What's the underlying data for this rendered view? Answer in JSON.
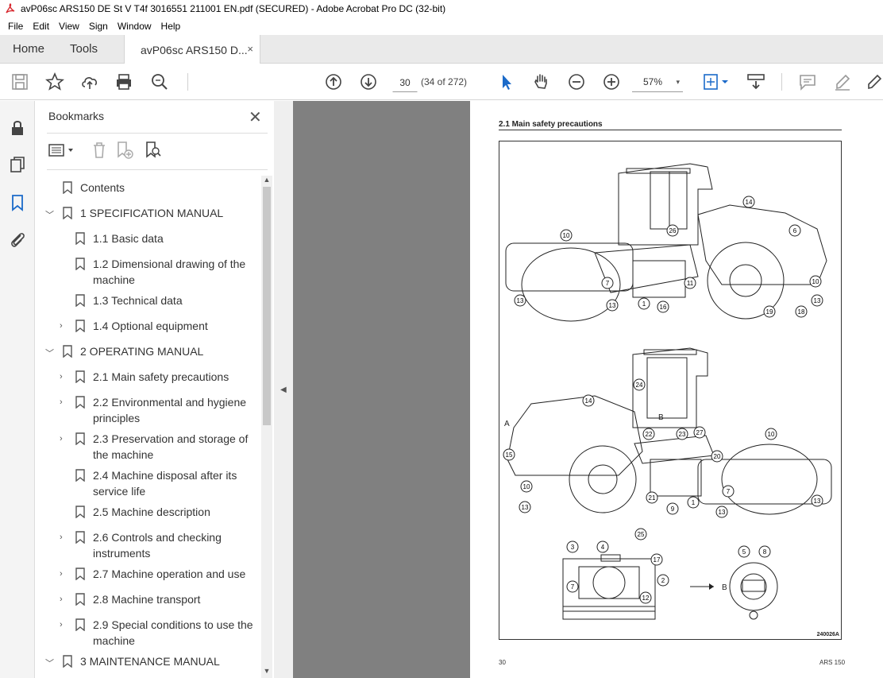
{
  "window": {
    "title": "avP06sc ARS150 DE St V T4f 3016551 211001 EN.pdf (SECURED) - Adobe Acrobat Pro DC (32-bit)"
  },
  "menu": [
    "File",
    "Edit",
    "View",
    "Sign",
    "Window",
    "Help"
  ],
  "tabs": {
    "home": "Home",
    "tools": "Tools",
    "document": "avP06sc ARS150 D...",
    "document_close": "×"
  },
  "toolbar": {
    "page_number": "30",
    "page_count": "(34 of 272)",
    "zoom": "57%",
    "zoom_caret": "▾",
    "icons": [
      "save-icon",
      "star-icon",
      "upload-icon",
      "print-icon",
      "find-icon",
      "page-up-icon",
      "page-down-icon",
      "select-cursor-icon",
      "hand-icon",
      "zoom-out-icon",
      "zoom-in-icon",
      "fit-page-icon",
      "scroll-mode-icon",
      "comment-icon",
      "highlight-icon",
      "sign-icon"
    ]
  },
  "sidebar_rail": {
    "icons": [
      "lock-icon",
      "pages-icon",
      "bookmark-icon",
      "attachment-icon"
    ]
  },
  "bookmarks": {
    "title": "Bookmarks",
    "close": "✕",
    "items": [
      {
        "label": "Contents",
        "level": 0,
        "chevron": "",
        "lines": 1
      },
      {
        "label": "1 SPECIFICATION MANUAL",
        "level": 0,
        "chevron": "﹀",
        "lines": 1
      },
      {
        "label": "1.1 Basic data",
        "level": 1,
        "chevron": "",
        "lines": 1
      },
      {
        "label": "1.2 Dimensional drawing of the machine",
        "level": 1,
        "chevron": "",
        "lines": 2
      },
      {
        "label": "1.3 Technical data",
        "level": 1,
        "chevron": "",
        "lines": 1
      },
      {
        "label": "1.4 Optional equipment",
        "level": 1,
        "chevron": "›",
        "lines": 1
      },
      {
        "label": "2 OPERATING MANUAL",
        "level": 0,
        "chevron": "﹀",
        "lines": 1
      },
      {
        "label": "2.1 Main safety precautions",
        "level": 1,
        "chevron": "›",
        "lines": 1
      },
      {
        "label": "2.2 Environmental and hygiene principles",
        "level": 1,
        "chevron": "›",
        "lines": 2
      },
      {
        "label": "2.3 Preservation and storage of the machine",
        "level": 1,
        "chevron": "›",
        "lines": 2
      },
      {
        "label": "2.4 Machine disposal after its service life",
        "level": 1,
        "chevron": "",
        "lines": 2
      },
      {
        "label": "2.5 Machine description",
        "level": 1,
        "chevron": "",
        "lines": 1
      },
      {
        "label": "2.6 Controls and checking instruments",
        "level": 1,
        "chevron": "›",
        "lines": 2
      },
      {
        "label": "2.7 Machine operation and use",
        "level": 1,
        "chevron": "›",
        "lines": 1
      },
      {
        "label": "2.8 Machine transport",
        "level": 1,
        "chevron": "›",
        "lines": 1
      },
      {
        "label": "2.9 Special conditions to use the machine",
        "level": 1,
        "chevron": "›",
        "lines": 2
      },
      {
        "label": "3 MAINTENANCE MANUAL",
        "level": 0,
        "chevron": "﹀",
        "lines": 1
      }
    ]
  },
  "document": {
    "section": "2.1        Main safety precautions",
    "figure_code": "240026A",
    "page_number": "30",
    "model": "ARS 150",
    "callouts_top": [
      "10",
      "14",
      "26",
      "6",
      "7",
      "11",
      "10",
      "13",
      "13",
      "1",
      "16",
      "19",
      "18",
      "13"
    ],
    "callouts_mid": [
      "24",
      "14",
      "A",
      "B",
      "22",
      "23",
      "27",
      "10",
      "15",
      "20",
      "7",
      "10",
      "13",
      "21",
      "9",
      "1",
      "13",
      "13"
    ],
    "callouts_bottom": [
      "3",
      "4",
      "25",
      "17",
      "2",
      "7",
      "12",
      "B",
      "5",
      "8"
    ]
  }
}
